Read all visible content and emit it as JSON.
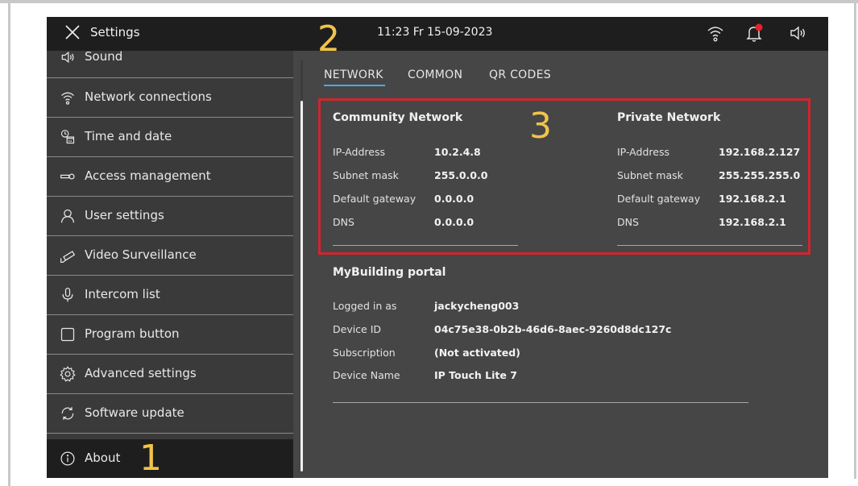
{
  "topbar": {
    "title": "Settings",
    "clock": "11:23  Fr 15-09-2023"
  },
  "annotations": {
    "marker_1": "1",
    "marker_2": "2",
    "marker_3": "3"
  },
  "sidebar": {
    "items": [
      {
        "label": "Sound",
        "icon": "speaker-icon"
      },
      {
        "label": "Network connections",
        "icon": "wifi-icon"
      },
      {
        "label": "Time and date",
        "icon": "clock-calendar-icon"
      },
      {
        "label": "Access  management",
        "icon": "key-icon"
      },
      {
        "label": "User settings",
        "icon": "user-icon"
      },
      {
        "label": "Video Surveillance",
        "icon": "camera-icon"
      },
      {
        "label": "Intercom list",
        "icon": "microphone-icon"
      },
      {
        "label": "Program button",
        "icon": "square-button-icon"
      },
      {
        "label": "Advanced settings",
        "icon": "gear-icon"
      },
      {
        "label": "Software update",
        "icon": "refresh-icon"
      },
      {
        "label": "About",
        "icon": "info-icon",
        "active": true
      }
    ]
  },
  "tabs": [
    "NETWORK",
    "COMMON",
    "QR CODES"
  ],
  "community_network": {
    "title": "Community Network",
    "rows": [
      {
        "label": "IP-Address",
        "value": "10.2.4.8"
      },
      {
        "label": "Subnet mask",
        "value": "255.0.0.0"
      },
      {
        "label": "Default gateway",
        "value": "0.0.0.0"
      },
      {
        "label": "DNS",
        "value": "0.0.0.0"
      }
    ]
  },
  "private_network": {
    "title": "Private Network",
    "rows": [
      {
        "label": "IP-Address",
        "value": "192.168.2.127"
      },
      {
        "label": "Subnet mask",
        "value": "255.255.255.0"
      },
      {
        "label": "Default gateway",
        "value": "192.168.2.1"
      },
      {
        "label": "DNS",
        "value": "192.168.2.1"
      }
    ]
  },
  "portal": {
    "title": "MyBuilding portal",
    "rows": [
      {
        "label": "Logged in as",
        "value": "jackycheng003"
      },
      {
        "label": "Device ID",
        "value": "04c75e38-0b2b-46d6-8aec-9260d8dc127c"
      },
      {
        "label": "Subscription",
        "value": "(Not activated)"
      },
      {
        "label": "Device Name",
        "value": "IP Touch Lite 7"
      }
    ]
  },
  "colors": {
    "accent_tab": "#4aa8e8",
    "highlight_box": "#d3242f",
    "annotation": "#f0c34a",
    "notification_dot": "#e8202a"
  }
}
